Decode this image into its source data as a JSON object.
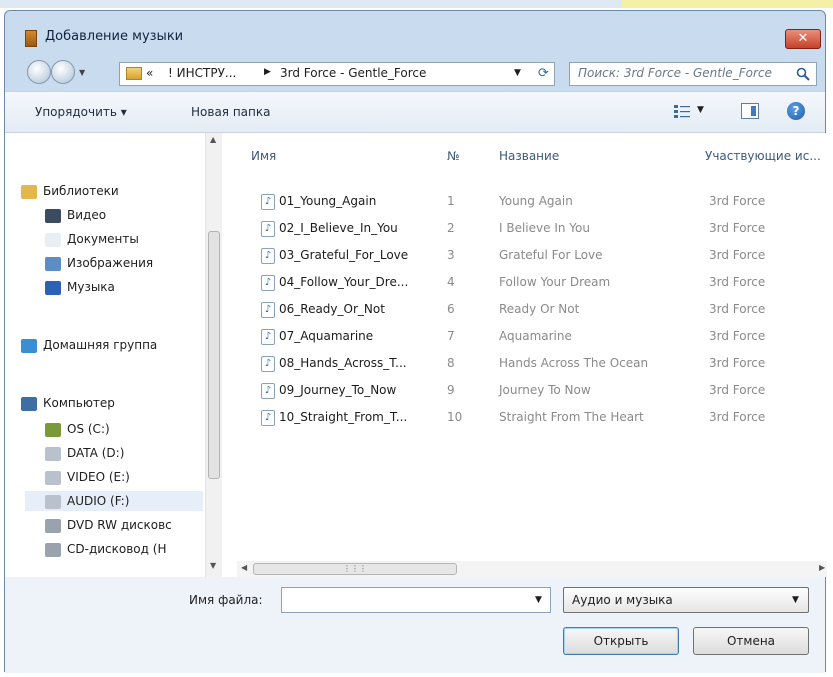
{
  "window": {
    "title": "Добавление музыки",
    "close_label": "✕"
  },
  "nav": {
    "breadcrumb": {
      "chevron": "«",
      "segments": [
        "! ИНСТРУ...",
        "3rd Force - Gentle_Force"
      ]
    },
    "search_placeholder": "Поиск: 3rd Force - Gentle_Force"
  },
  "toolbar": {
    "organize": "Упорядочить ▾",
    "new_folder": "Новая папка",
    "help": "?"
  },
  "sidebar": {
    "items": [
      {
        "label": "Библиотеки",
        "icon": "libraries-icon"
      },
      {
        "label": "Видео",
        "icon": "video-icon"
      },
      {
        "label": "Документы",
        "icon": "documents-icon"
      },
      {
        "label": "Изображения",
        "icon": "pictures-icon"
      },
      {
        "label": "Музыка",
        "icon": "music-icon"
      },
      {
        "label": "Домашняя группа",
        "icon": "homegroup-icon"
      },
      {
        "label": "Компьютер",
        "icon": "computer-icon"
      },
      {
        "label": "OS (C:)",
        "icon": "drive-c-icon"
      },
      {
        "label": "DATA (D:)",
        "icon": "drive-icon"
      },
      {
        "label": "VIDEO (E:)",
        "icon": "drive-icon"
      },
      {
        "label": "AUDIO (F:)",
        "icon": "drive-icon",
        "selected": true
      },
      {
        "label": "DVD RW дисковс",
        "icon": "optical-drive-icon"
      },
      {
        "label": "CD-дисковод (H",
        "icon": "optical-drive-icon"
      }
    ]
  },
  "files": {
    "columns": [
      "Имя",
      "№",
      "Название",
      "Участвующие ис..."
    ],
    "rows": [
      {
        "name": "01_Young_Again",
        "num": "1",
        "title": "Young Again",
        "artist": "3rd Force"
      },
      {
        "name": "02_I_Believe_In_You",
        "num": "2",
        "title": "I Believe In You",
        "artist": "3rd Force"
      },
      {
        "name": "03_Grateful_For_Love",
        "num": "3",
        "title": "Grateful For Love",
        "artist": "3rd Force"
      },
      {
        "name": "04_Follow_Your_Dre...",
        "num": "4",
        "title": "Follow Your Dream",
        "artist": "3rd Force"
      },
      {
        "name": "06_Ready_Or_Not",
        "num": "6",
        "title": "Ready Or Not",
        "artist": "3rd Force"
      },
      {
        "name": "07_Aquamarine",
        "num": "7",
        "title": "Aquamarine",
        "artist": "3rd Force"
      },
      {
        "name": "08_Hands_Across_T...",
        "num": "8",
        "title": "Hands Across The Ocean",
        "artist": "3rd Force"
      },
      {
        "name": "09_Journey_To_Now",
        "num": "9",
        "title": "Journey To Now",
        "artist": "3rd Force"
      },
      {
        "name": "10_Straight_From_T...",
        "num": "10",
        "title": "Straight From The Heart",
        "artist": "3rd Force"
      }
    ]
  },
  "footer": {
    "filename_label": "Имя файла:",
    "filename_value": "",
    "filetype": "Аудио и музыка",
    "open": "Открыть",
    "cancel": "Отмена"
  },
  "colors": {
    "accent": "#3c7fb1",
    "selection": "#e5eef9",
    "window_frame": "#c9dcef"
  }
}
